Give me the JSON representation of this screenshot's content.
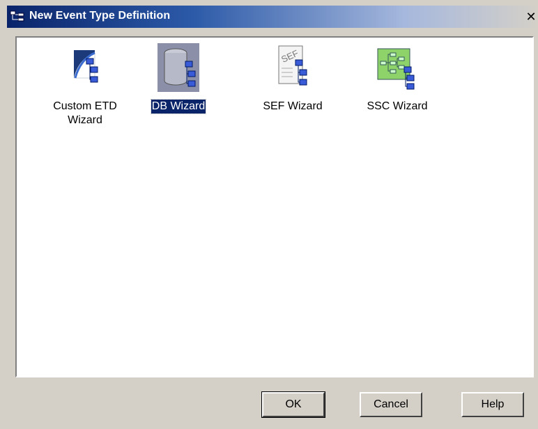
{
  "window": {
    "title": "New Event Type Definition",
    "close_glyph": "✕"
  },
  "items": [
    {
      "label_line1": "Custom ETD",
      "label_line2": "Wizard",
      "icon": "custom-etd-icon",
      "selected": false
    },
    {
      "label": "DB Wizard",
      "icon": "database-icon",
      "selected": true
    },
    {
      "label": "SEF Wizard",
      "icon": "sef-document-icon",
      "selected": false
    },
    {
      "label": "SSC Wizard",
      "icon": "ssc-diagram-icon",
      "selected": false
    }
  ],
  "buttons": {
    "ok": "OK",
    "cancel": "Cancel",
    "help": "Help"
  },
  "colors": {
    "title_bar_start": "#0a246a",
    "selection": "#0a246a",
    "dialog_background": "#d4d0c8"
  }
}
